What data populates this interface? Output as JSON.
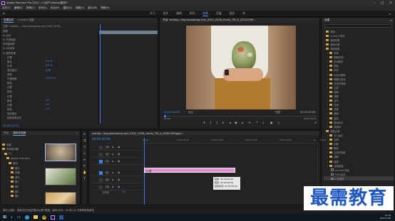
{
  "window": {
    "title": "Adobe Premiere Pro 2020 - C:\\用户\\Videos\\素材\\*"
  },
  "menu": [
    "文件(F)",
    "编辑(E)",
    "剪辑(C)",
    "序列(S)",
    "标记(M)",
    "图形(G)",
    "视图(V)",
    "窗口(W)",
    "帮助(H)"
  ],
  "workspaces": [
    "学习",
    "组件",
    "编辑",
    "颜色",
    "效果",
    "音频",
    "图形",
    "库"
  ],
  "active_workspace": "效果",
  "effect_controls": {
    "tabs": [
      "效果控件",
      "Lumetri 范围"
    ],
    "source_label": "主要 * zomlby_...img.tessswong.com_2021_0226_...",
    "rows": [
      {
        "label": "视频",
        "value": ""
      },
      {
        "label": "fx 运动",
        "value": ""
      },
      {
        "label": "fx 不透明度",
        "value": ""
      },
      {
        "label": "时间重映射",
        "value": ""
      },
      {
        "label": "fx 4色渐变",
        "value": ""
      },
      {
        "label": "fx 裁剪效果",
        "value": ""
      },
      {
        "label": "位置",
        "value": ""
      },
      {
        "label": "融合",
        "value": "0.0 %"
      },
      {
        "label": "抖动",
        "value": "0.0 %"
      },
      {
        "label": "混合模式",
        "value": "正常"
      },
      {
        "label": "滤镜",
        "value": ""
      },
      {
        "label": "不透明度",
        "value": "100.0 %"
      },
      {
        "label": "颜色",
        "value": ""
      },
      {
        "label": "位置",
        "value": ""
      },
      {
        "label": "颜色",
        "value": ""
      },
      {
        "label": "位置",
        "value": ""
      },
      {
        "label": "颜色",
        "value": "1.0"
      },
      {
        "label": "位置",
        "value": "3.0"
      },
      {
        "label": "颜色",
        "value": "1.0"
      },
      {
        "label": "保持固定",
        "value": ""
      },
      {
        "label": "粘贴效果控件",
        "value": ""
      }
    ],
    "timecode": "00:00:00:00"
  },
  "program_monitor": {
    "title": "节目: zomlby...img.tessswong.com_2021_0226_Hunts_TM_Q_20201009...",
    "timecode_left": "00:00:00:00",
    "fit_label": "适合",
    "quality_label": "完整",
    "timecode_right": "00:00:05:00",
    "ruler_left": "00:00",
    "ruler_right": "00:00:05:00"
  },
  "effects_panel": {
    "tab": "效果",
    "items": [
      "预设",
      "Lumetri 预设",
      "音频效果",
      "音频过渡",
      "视频效果",
      "变换",
      "图像控制",
      "实用程序",
      "扭曲",
      "时间",
      "杂色与颗粒",
      "模糊与锐化",
      "沉浸式视频",
      "生成",
      "视频",
      "调整",
      "过时",
      "过渡",
      "透视",
      "通道",
      "键控",
      "颜色校正",
      "风格化",
      "视频过渡",
      "3D 运动",
      "内滑",
      "划像",
      "擦除",
      "沉浸式视频",
      "溶解",
      "缩放",
      "页面剥落"
    ],
    "items_end_a": "Lumetri 颜色",
    "items_end_b": "RGB 曲线",
    "items_end_c": "4 色渐变"
  },
  "project_panel": {
    "tabs": [
      "项目",
      "媒体浏览器"
    ],
    "tree": [
      "收藏",
      "本地驱动器",
      "C:\\",
      "Adobe Premiere",
      "素材",
      "图片",
      "视频",
      "音乐",
      "图1",
      "图2",
      "图3",
      "图4"
    ]
  },
  "timeline": {
    "title": "zomlby...img.tessswong.com_2021_0226_Hunts_TM_Q_20201009pgnf...",
    "timecode": "00:00:00:00",
    "tracks": [
      "V3",
      "V2",
      "V1",
      "A1",
      "A2",
      "A3"
    ],
    "master_label": "主声道",
    "master_value": "0.0",
    "clip_label": "fx 图",
    "ruler": [
      "00:00",
      "00:00:05:00",
      "00:00:10:00",
      "00:00:15:00",
      "00:00:20:00",
      "00:00:25:00"
    ],
    "tooltip": [
      "起始: 00:00:00:00",
      "结束: 00:00:05:00",
      "持续时间: 00:00:05:00"
    ]
  },
  "status_bar": {
    "text": "单击以选择，或单击空白处并拖动以进行框选。使用 Shift、Alt 和 Ctrl 可获得其他选项。"
  },
  "watermark": {
    "text": "最需教育"
  },
  "taskbar": {
    "time": "11:18",
    "date": "2021/11/8"
  },
  "colors": {
    "accent_blue": "#2d8ceb",
    "clip_pink": "#e58ad6",
    "playhead": "#3d7cf5",
    "watermark": "#1c56c9"
  }
}
